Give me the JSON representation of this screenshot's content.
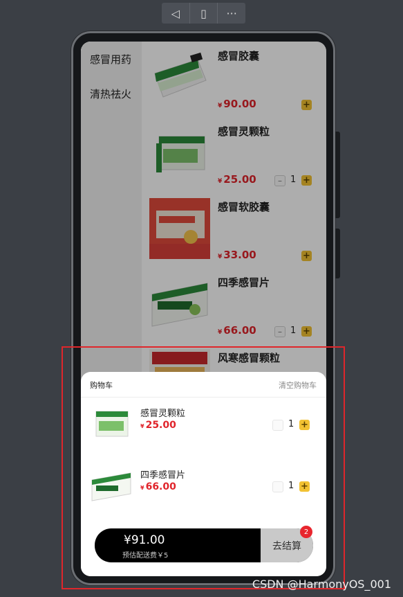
{
  "toolbar": {
    "back_icon": "◁",
    "fold_icon": "▯",
    "more_icon": "···"
  },
  "categories": [
    {
      "label": "感冒用药"
    },
    {
      "label": "清热祛火"
    }
  ],
  "products": [
    {
      "name": "感冒胶囊",
      "currency": "¥",
      "price": "90.00",
      "qty": "",
      "plus": "+",
      "minus": ""
    },
    {
      "name": "感冒灵颗粒",
      "currency": "¥",
      "price": "25.00",
      "qty": "1",
      "plus": "+",
      "minus": "–"
    },
    {
      "name": "感冒软胶囊",
      "currency": "¥",
      "price": "33.00",
      "qty": "",
      "plus": "+",
      "minus": ""
    },
    {
      "name": "四季感冒片",
      "currency": "¥",
      "price": "66.00",
      "qty": "1",
      "plus": "+",
      "minus": "–"
    },
    {
      "name": "风寒感冒颗粒",
      "currency": "",
      "price": "",
      "qty": "",
      "plus": "",
      "minus": ""
    }
  ],
  "cart": {
    "title": "购物车",
    "clear_label": "清空购物车",
    "items": [
      {
        "name": "感冒灵颗粒",
        "currency": "¥",
        "price": "25.00",
        "qty": "1",
        "plus": "+"
      },
      {
        "name": "四季感冒片",
        "currency": "¥",
        "price": "66.00",
        "qty": "1",
        "plus": "+"
      }
    ],
    "total": "¥91.00",
    "delivery_fee": "预估配送费￥5",
    "checkout_label": "去结算",
    "badge_count": "2"
  },
  "watermark": "CSDN @HarmonyOS_001",
  "colors": {
    "price_red": "#e0242b",
    "plus_yellow": "#f2c233",
    "highlight_frame": "#e0262b"
  }
}
